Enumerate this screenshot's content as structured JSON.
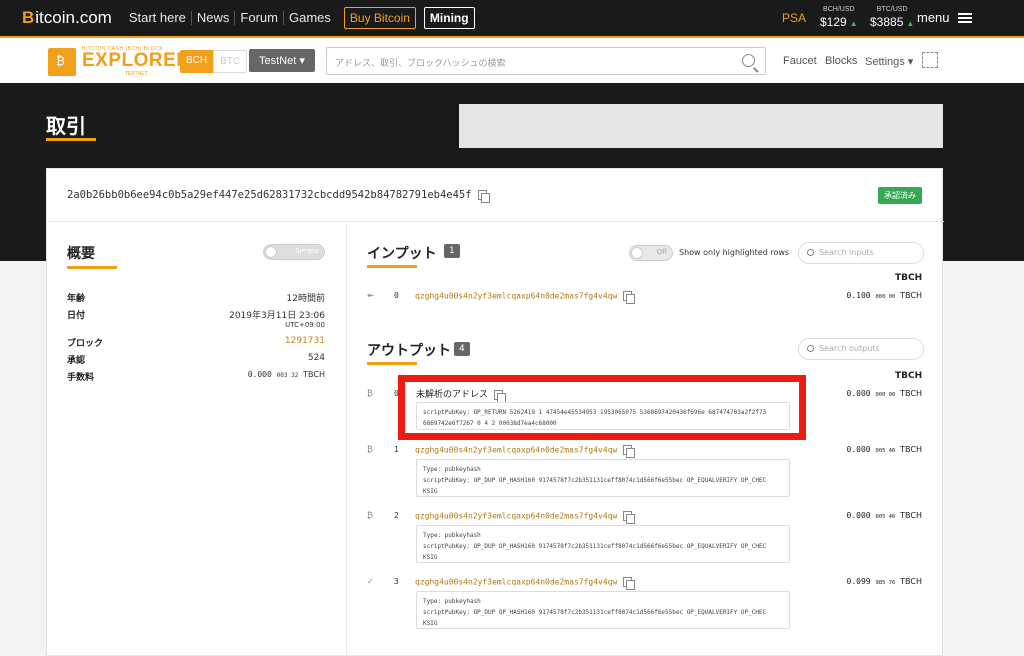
{
  "topbar": {
    "brand_b": "B",
    "brand_rest": "itcoin.com",
    "nav": [
      "Start here",
      "News",
      "Forum",
      "Games"
    ],
    "buy_label": "Buy Bitcoin",
    "mining_label": "Mining",
    "psa": "PSA",
    "bch_label": "BCH/USD",
    "bch_price": "$129",
    "btc_label": "BTC/USD",
    "btc_price": "$3885",
    "menu_label": "menu"
  },
  "header": {
    "logo_small": "BITCOIN CASH (BCH) BLOCK",
    "logo_big": "EXPLORER",
    "logo_net": "TESTNET",
    "coin_bch": "BCH",
    "coin_btc": "BTC",
    "network": "TestNet ▾",
    "search_placeholder": "アドレス、取引、ブロックハッシュの検索",
    "nav_faucet": "Faucet",
    "nav_blocks": "Blocks",
    "nav_settings": "Settings ▾"
  },
  "page": {
    "title": "取引",
    "txid": "2a0b26bb0b6ee94c0b5a29ef447e25d62831732cbcdd9542b84782791eb4e45f",
    "status": "承認済み"
  },
  "summary": {
    "title": "概要",
    "simple_label": "Simple",
    "age_key": "年齢",
    "age_val": "12時間前",
    "date_key": "日付",
    "date_val": "2019年3月11日 23:06",
    "date_tz": "UTC+09:00",
    "block_key": "ブロック",
    "block_val": "1291731",
    "conf_key": "承認",
    "conf_val": "524",
    "fee_key": "手数料",
    "fee_main": "0.000",
    "fee_small": "003 32",
    "fee_unit": "TBCH"
  },
  "inputs": {
    "title": "インプット",
    "count": "1",
    "toggle_off": "Off",
    "toggle_label": "Show only highlighted rows",
    "search_placeholder": "Search inputs",
    "unit": "TBCH",
    "rows": [
      {
        "icon": "↞",
        "idx": "0",
        "addr": "qzghg4u00s4n2yf3emlcqaxp64n0de2mas7fg4v4qw",
        "amt_main": "0.100",
        "amt_small": "000 00",
        "unit": "TBCH"
      }
    ]
  },
  "outputs": {
    "title": "アウトプット",
    "count": "4",
    "search_placeholder": "Search outputs",
    "unit": "TBCH",
    "unparsed_label": "未解析のアドレス",
    "rows": [
      {
        "icon": "₿",
        "idx": "0",
        "amt_main": "0.000",
        "amt_small": "000 00",
        "unit": "TBCH",
        "script1": "scriptPubKey: OP_RETURN 5262419 1 47454e45534953 1953065075 5368697420436f696e 687474703a2f2f73",
        "script2": "6869742e6f7267 0 4 2 00038d7ea4c68000"
      },
      {
        "icon": "₿",
        "idx": "1",
        "addr": "qzghg4u00s4n2yf3emlcqaxp64n0de2mas7fg4v4qw",
        "amt_main": "0.000",
        "amt_small": "005 46",
        "unit": "TBCH",
        "type": "Type: pubkeyhash",
        "script1": "scriptPubKey: OP_DUP OP_HASH160 9174578f7c2b351131ceff8074c1d566f6e55bec OP_EQUALVERIFY OP_CHEC",
        "script2": "KSIG"
      },
      {
        "icon": "₿",
        "idx": "2",
        "addr": "qzghg4u00s4n2yf3emlcqaxp64n0de2mas7fg4v4qw",
        "amt_main": "0.000",
        "amt_small": "005 46",
        "unit": "TBCH",
        "type": "Type: pubkeyhash",
        "script1": "scriptPubKey: OP_DUP OP_HASH160 9174578f7c2b351131ceff8074c1d566f6e55bec OP_EQUALVERIFY OP_CHEC",
        "script2": "KSIG"
      },
      {
        "icon": "✓",
        "idx": "3",
        "addr": "qzghg4u00s4n2yf3emlcqaxp64n0de2mas7fg4v4qw",
        "amt_main": "0.099",
        "amt_small": "985 76",
        "unit": "TBCH",
        "type": "Type: pubkeyhash",
        "script1": "scriptPubKey: OP_DUP OP_HASH160 9174578f7c2b351131ceff8074c1d566f6e55bec OP_EQUALVERIFY OP_CHEC",
        "script2": "KSIG"
      }
    ]
  },
  "colors": {
    "accent": "#f0a019",
    "highlight_frame": "#ee1c0e",
    "confirm": "#34a853"
  }
}
